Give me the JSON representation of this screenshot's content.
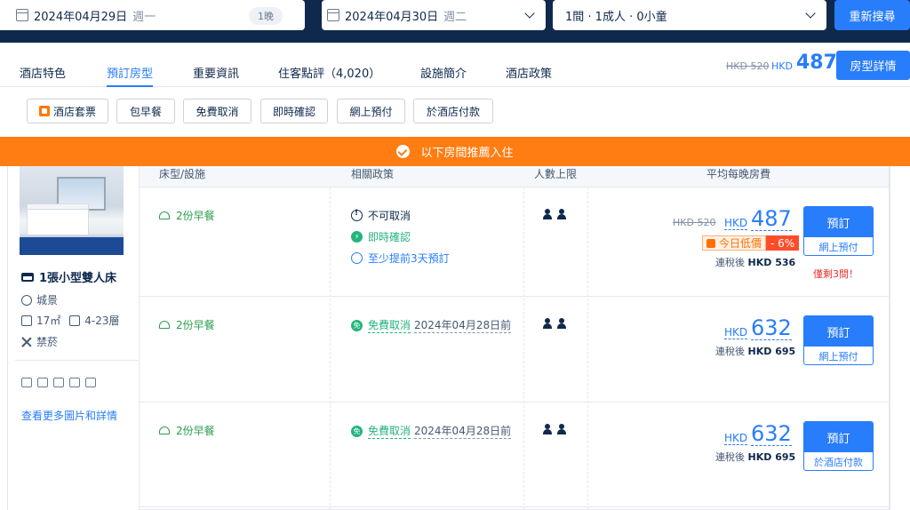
{
  "search": {
    "checkin_date": "2024年04月29日",
    "checkin_weekday": "週一",
    "nights": "1晚",
    "checkout_date": "2024年04月30日",
    "checkout_weekday": "週二",
    "guests": "1間 · 1成人 · 0小童",
    "search_button": "重新搜尋"
  },
  "tabs": [
    {
      "label": "酒店特色"
    },
    {
      "label": "預訂房型"
    },
    {
      "label": "重要資訊"
    },
    {
      "label": "住客點評（4,020）"
    },
    {
      "label": "設施簡介"
    },
    {
      "label": "酒店政策"
    }
  ],
  "header_price": {
    "old": "HKD 520",
    "currency": "HKD",
    "current": "487",
    "room_detail_button": "房型詳情"
  },
  "filters": [
    "酒店套票",
    "包早餐",
    "免費取消",
    "即時確認",
    "網上預付",
    "於酒店付款"
  ],
  "banner": "以下房間推薦入住",
  "room": {
    "name": "1張小型雙人床",
    "view": "城景",
    "size": "17㎡",
    "floor": "4-23層",
    "smoking": "禁菸",
    "more_link": "查看更多圖片和詳情"
  },
  "table_headers": {
    "bed": "床型/設施",
    "policy": "相關政策",
    "capacity": "人數上限",
    "price": "平均每晚房費"
  },
  "rows": [
    {
      "breakfast": "2份早餐",
      "policy_1": "不可取消",
      "policy_2": "即時確認",
      "policy_3": "至少提前3天預訂",
      "price_old": "HKD 520",
      "currency": "HKD",
      "price": "487",
      "deal_label": "今日低價",
      "deal_pct": "- 6%",
      "tax_label": "連稅後",
      "tax_value": "HKD 536",
      "book": "預訂",
      "pay": "網上預付",
      "rooms_left": "僅剩3間！"
    },
    {
      "breakfast": "2份早餐",
      "free_cancel": "免費取消",
      "free_cancel_date": "2024年04月28日前",
      "currency": "HKD",
      "price": "632",
      "tax_label": "連稅後",
      "tax_value": "HKD 695",
      "book": "預訂",
      "pay": "網上預付"
    },
    {
      "breakfast": "2份早餐",
      "free_cancel": "免費取消",
      "free_cancel_date": "2024年04月28日前",
      "currency": "HKD",
      "price": "632",
      "tax_label": "連稅後",
      "tax_value": "HKD 695",
      "book": "預訂",
      "pay": "於酒店付款"
    }
  ],
  "colors": {
    "primary": "#287dfa",
    "navy": "#0f294d",
    "banner_orange": "#ff7d13",
    "green": "#24b47e"
  }
}
